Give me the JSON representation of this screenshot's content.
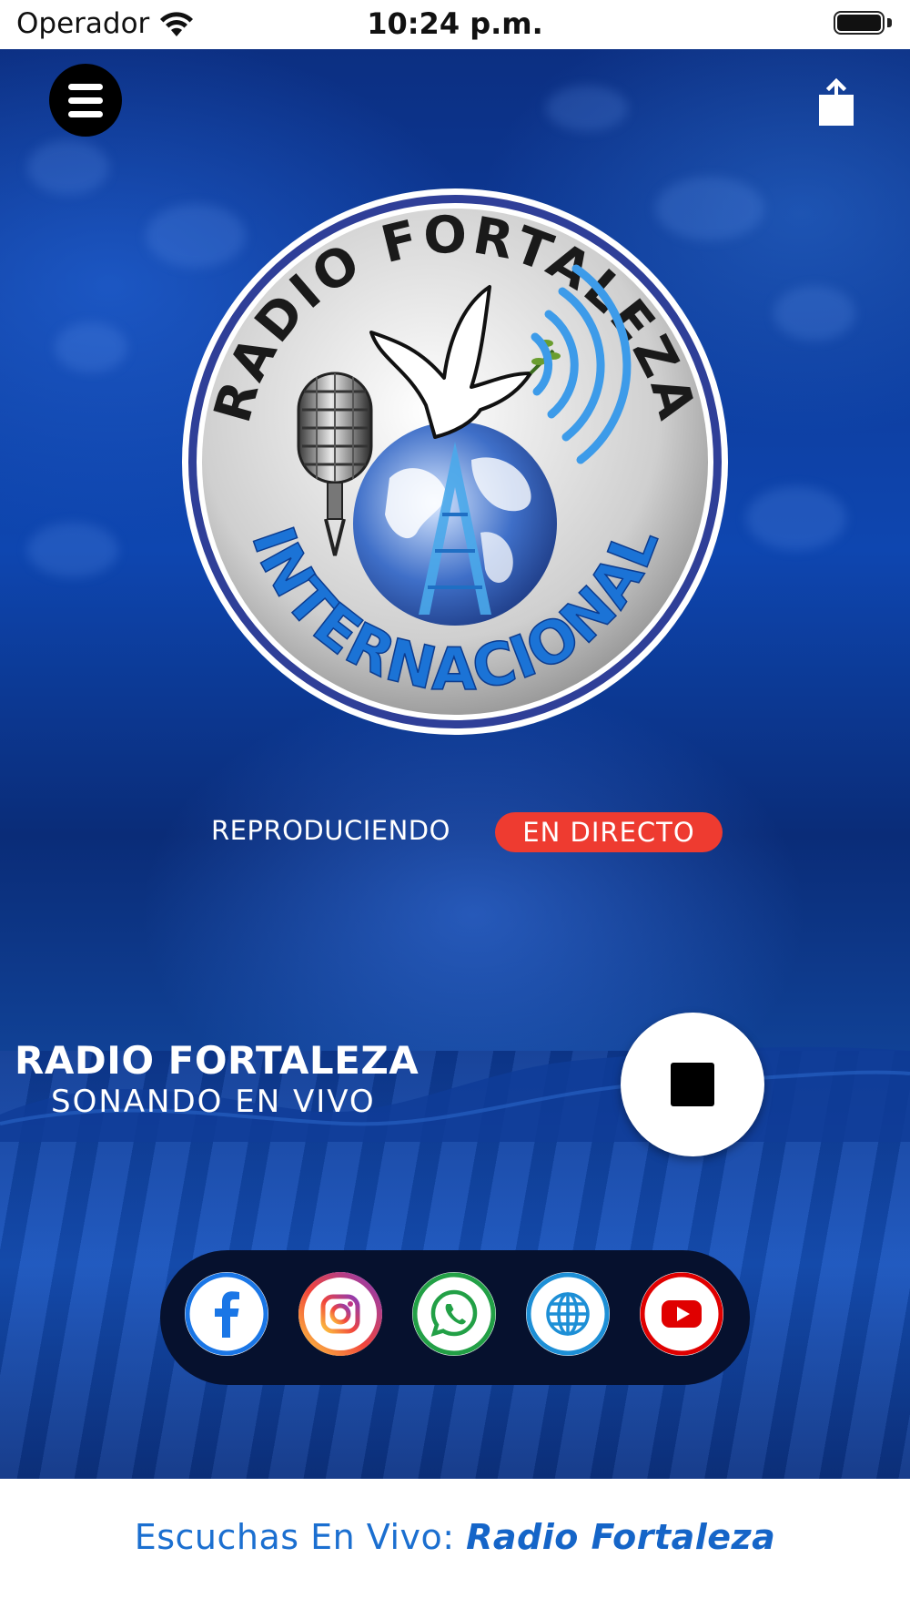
{
  "status_bar": {
    "carrier": "Operador",
    "time": "10:24 p.m."
  },
  "logo": {
    "top_text": "RADIO FORTALEZA",
    "bottom_text": "INTERNACIONAL"
  },
  "player": {
    "status_label": "REPRODUCIENDO",
    "live_badge": "EN  DIRECTO",
    "station_name": "RADIO FORTALEZA",
    "station_subtitle": "SONANDO  EN  VIVO"
  },
  "social": [
    {
      "name": "facebook",
      "icon": "facebook-icon",
      "color": "#1877f2"
    },
    {
      "name": "instagram",
      "icon": "instagram-icon",
      "color": "#e1306c"
    },
    {
      "name": "whatsapp",
      "icon": "whatsapp-icon",
      "color": "#25a244"
    },
    {
      "name": "website",
      "icon": "globe-icon",
      "color": "#1d8fd6"
    },
    {
      "name": "youtube",
      "icon": "youtube-icon",
      "color": "#e00000"
    }
  ],
  "footer": {
    "prefix": "Escuchas En Vivo: ",
    "station": "Radio Fortaleza"
  },
  "colors": {
    "live_badge": "#ee3b30",
    "footer_text": "#1b6fd0",
    "background": "#0e46b0"
  }
}
